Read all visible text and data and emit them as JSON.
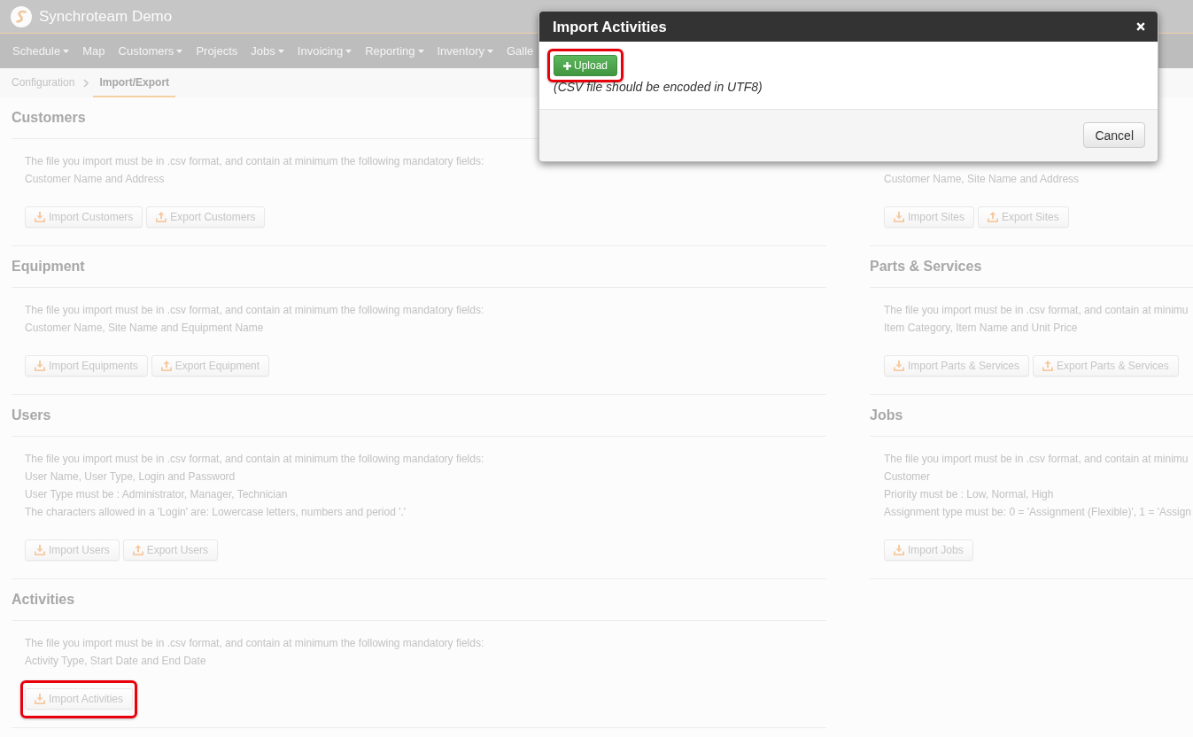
{
  "app": {
    "title": "Synchroteam Demo"
  },
  "nav": [
    {
      "label": "Schedule",
      "dropdown": true
    },
    {
      "label": "Map",
      "dropdown": false
    },
    {
      "label": "Customers",
      "dropdown": true
    },
    {
      "label": "Projects",
      "dropdown": false
    },
    {
      "label": "Jobs",
      "dropdown": true
    },
    {
      "label": "Invoicing",
      "dropdown": true
    },
    {
      "label": "Reporting",
      "dropdown": true
    },
    {
      "label": "Inventory",
      "dropdown": true
    },
    {
      "label": "Galle",
      "dropdown": false
    }
  ],
  "breadcrumb": [
    {
      "label": "Configuration",
      "selected": false
    },
    {
      "label": "Import/Export",
      "selected": true
    }
  ],
  "columns": [
    {
      "sections": [
        {
          "title": "Customers",
          "description": [
            "The file you import must be in .csv format, and contain at minimum the following mandatory fields:",
            "Customer Name and Address"
          ],
          "buttons": [
            {
              "label": "Import Customers",
              "kind": "import",
              "highlighted": false
            },
            {
              "label": "Export Customers",
              "kind": "export",
              "highlighted": false
            }
          ]
        },
        {
          "title": "Equipment",
          "description": [
            "The file you import must be in .csv format, and contain at minimum the following mandatory fields:",
            "Customer Name, Site Name and Equipment Name"
          ],
          "buttons": [
            {
              "label": "Import Equipments",
              "kind": "import",
              "highlighted": false
            },
            {
              "label": "Export Equipment",
              "kind": "export",
              "highlighted": false
            }
          ]
        },
        {
          "title": "Users",
          "description": [
            "The file you import must be in .csv format, and contain at minimum the following mandatory fields:",
            "User Name, User Type, Login and Password",
            "User Type must be : Administrator, Manager, Technician",
            "The characters allowed in a 'Login' are: Lowercase letters, numbers and period '.'"
          ],
          "buttons": [
            {
              "label": "Import Users",
              "kind": "import",
              "highlighted": false
            },
            {
              "label": "Export Users",
              "kind": "export",
              "highlighted": false
            }
          ]
        },
        {
          "title": "Activities",
          "description": [
            "The file you import must be in .csv format, and contain at minimum the following mandatory fields:",
            "Activity Type, Start Date and End Date"
          ],
          "buttons": [
            {
              "label": "Import Activities",
              "kind": "import",
              "highlighted": true
            }
          ]
        }
      ]
    },
    {
      "sections": [
        {
          "description": [
            "Customer Name, Site Name and Address"
          ],
          "buttons": [
            {
              "label": "Import Sites",
              "kind": "import",
              "highlighted": false
            },
            {
              "label": "Export Sites",
              "kind": "export",
              "highlighted": false
            }
          ]
        },
        {
          "title": "Parts & Services",
          "description": [
            "The file you import must be in .csv format, and contain at minimu",
            "Item Category, Item Name and Unit Price"
          ],
          "buttons": [
            {
              "label": "Import Parts & Services",
              "kind": "import",
              "highlighted": false
            },
            {
              "label": "Export Parts & Services",
              "kind": "export",
              "highlighted": false
            }
          ]
        },
        {
          "title": "Jobs",
          "description": [
            "The file you import must be in .csv format, and contain at minimu",
            "Customer",
            "Priority must be : Low, Normal, High",
            "Assignment type must be: 0 = 'Assignment (Flexible)', 1 = 'Assign"
          ],
          "buttons": [
            {
              "label": "Import Jobs",
              "kind": "import",
              "highlighted": false
            }
          ]
        }
      ]
    }
  ],
  "modal": {
    "title": "Import Activities",
    "upload_button": {
      "label": "Upload",
      "highlighted": true
    },
    "note": "(CSV file should be encoded in UTF8)",
    "cancel_button": "Cancel"
  }
}
